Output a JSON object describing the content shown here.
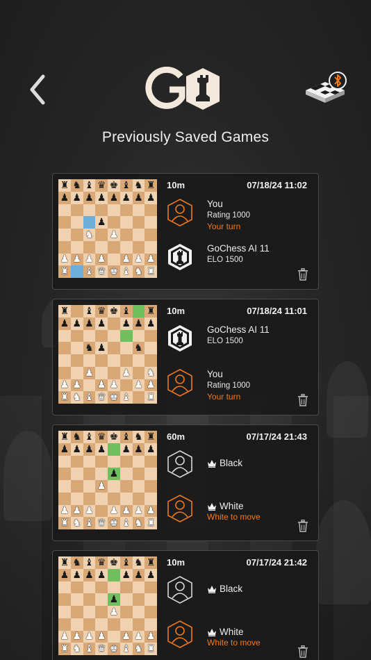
{
  "header": {
    "title": "Previously Saved Games"
  },
  "colors": {
    "accent": "#f07a1a",
    "card_bg": "#1a1a1a",
    "light_square": "#f0d2b0",
    "dark_square": "#d9a877",
    "highlight_green": "#6fbf5f",
    "highlight_blue": "#6eaed6"
  },
  "icons": {
    "back": "chevron-left-icon",
    "board_bluetooth": "bluetooth-board-icon",
    "delete": "trash-icon",
    "player": "user-hexagon-icon",
    "ai": "gochess-ai-icon",
    "crown": "crown-icon"
  },
  "games": [
    {
      "time_control": "10m",
      "date": "07/18/24 11:02",
      "top_player": {
        "name": "You",
        "line2": "Rating 1000",
        "status": "Your turn",
        "type": "user",
        "active": true
      },
      "bottom_player": {
        "name": "GoChess AI 11",
        "line2": "ELO 1500",
        "status": "",
        "type": "ai",
        "active": false
      },
      "board": [
        "rnbqkbnr",
        "pppppppp",
        "........",
        "...p....",
        "..N.P...",
        "........",
        "PPPP.PPP",
        "R.BQKBNR"
      ],
      "highlights": [
        {
          "sq": "c5",
          "color": "blue"
        },
        {
          "sq": "b1",
          "color": "blue"
        }
      ]
    },
    {
      "time_control": "10m",
      "date": "07/18/24 11:01",
      "top_player": {
        "name": "GoChess AI 11",
        "line2": "ELO 1500",
        "status": "",
        "type": "ai",
        "active": false
      },
      "bottom_player": {
        "name": "You",
        "line2": "Rating 1000",
        "status": "Your turn",
        "type": "user",
        "active": true
      },
      "board": [
        "r.bqkb.r",
        "pppp.ppp",
        "........",
        "..np..n.",
        "........",
        "..P..P.N",
        "PP.PP.PP",
        "RNBQKB.R"
      ],
      "highlights": [
        {
          "sq": "g8",
          "color": "green"
        },
        {
          "sq": "f6",
          "color": "green"
        }
      ]
    },
    {
      "time_control": "60m",
      "date": "07/17/24 21:43",
      "top_player": {
        "name": "Black",
        "line2": "",
        "status": "",
        "type": "user",
        "active": false,
        "crown": true
      },
      "bottom_player": {
        "name": "White",
        "line2": "",
        "status": "White to move",
        "type": "user",
        "active": true,
        "crown": true
      },
      "board": [
        "rnbqkbnr",
        "pppp.ppp",
        "........",
        "....p...",
        "...P....",
        "........",
        "PPP.PPPP",
        "RNBQKBNR"
      ],
      "highlights": [
        {
          "sq": "e7",
          "color": "green"
        },
        {
          "sq": "e5",
          "color": "green"
        }
      ]
    },
    {
      "time_control": "10m",
      "date": "07/17/24 21:42",
      "top_player": {
        "name": "Black",
        "line2": "",
        "status": "",
        "type": "user",
        "active": false,
        "crown": true
      },
      "bottom_player": {
        "name": "White",
        "line2": "",
        "status": "White to move",
        "type": "user",
        "active": true,
        "crown": true
      },
      "board": [
        "rnbqkbnr",
        "pppp.ppp",
        "........",
        "....p...",
        "....P...",
        "........",
        "PPPP.PPP",
        "RNBQKBNR"
      ],
      "highlights": [
        {
          "sq": "e7",
          "color": "green"
        },
        {
          "sq": "e5",
          "color": "green"
        }
      ]
    }
  ]
}
